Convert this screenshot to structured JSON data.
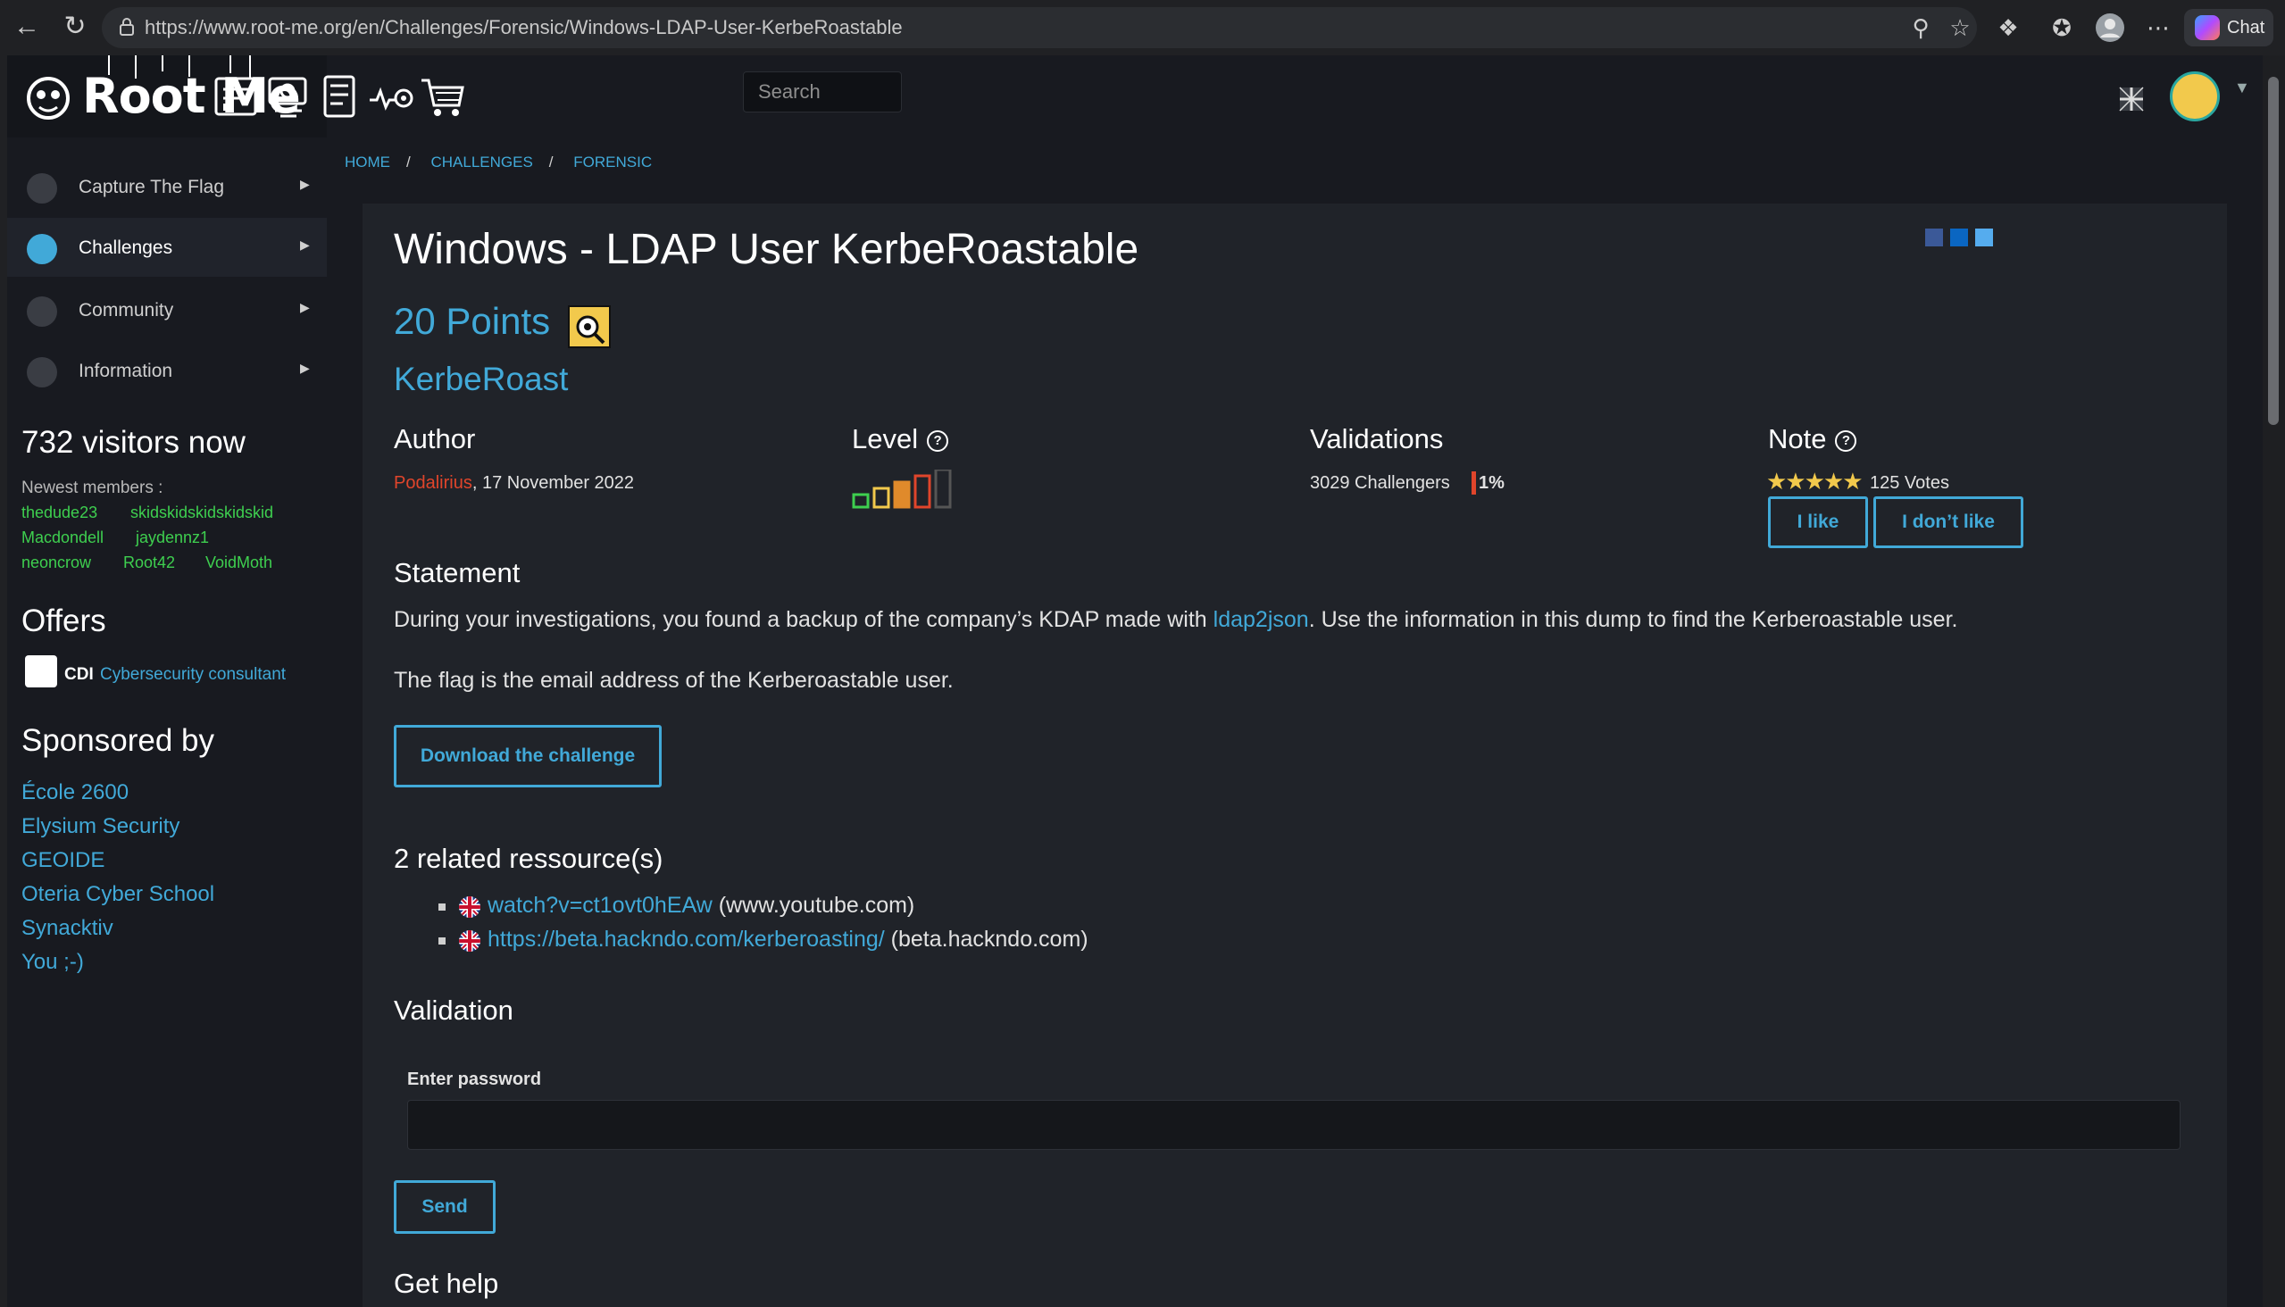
{
  "browser": {
    "url": "https://www.root-me.org/en/Challenges/Forensic/Windows-LDAP-User-KerbeRoastable",
    "chat_label": "Chat"
  },
  "header": {
    "logo_text": "Root Me",
    "search_placeholder": "Search",
    "icons": [
      "challenges-icon",
      "ctf-icon",
      "documentation-icon",
      "tools-icon",
      "shop-icon"
    ]
  },
  "sidebar": {
    "items": [
      {
        "label": "Capture The Flag",
        "icon": "flag-icon"
      },
      {
        "label": "Challenges",
        "icon": "challenges-icon"
      },
      {
        "label": "Community",
        "icon": "community-icon"
      },
      {
        "label": "Information",
        "icon": "information-icon"
      }
    ],
    "visitors": "732 visitors now",
    "newest_label": "Newest members :",
    "members": [
      "thedude23",
      "skidskidskidskidskid",
      "Macdondell",
      "jaydennz1",
      "neoncrow",
      "Root42",
      "VoidMoth"
    ],
    "offers_title": "Offers",
    "offer_company": "CDI",
    "offer_link": "Cybersecurity consultant",
    "sponsored_title": "Sponsored by",
    "sponsors": [
      "École 2600",
      "Elysium Security",
      "GEOIDE",
      "Oteria Cyber School",
      "Synacktiv",
      "You ;-)"
    ]
  },
  "breadcrumb": [
    "HOME",
    "CHALLENGES",
    "FORENSIC"
  ],
  "challenge": {
    "title": "Windows - LDAP User KerbeRoastable",
    "points": "20 Points",
    "tag": "KerbeRoast",
    "author_label": "Author",
    "author_name": "Podalirius",
    "author_date": ", 17 November 2022",
    "level_label": "Level",
    "level_value": 3,
    "level_max": 5,
    "validations_label": "Validations",
    "validations_count": "3029 Challengers",
    "validations_pct": "1%",
    "note_label": "Note",
    "stars": "★★★★★",
    "votes": "125 Votes",
    "like_label": "I like",
    "dislike_label": "I don’t like",
    "statement_title": "Statement",
    "statement_1a": "During your investigations, you found a backup of the company’s KDAP made with ",
    "statement_1_link": "ldap2json",
    "statement_1b": ". Use the information in this dump to find the Kerberoastable user.",
    "statement_2": "The flag is the email address of the Kerberoastable user.",
    "download_label": "Download the challenge",
    "resources_title": "2 related ressource(s)",
    "resources": [
      {
        "link": "watch?v=ct1ovt0hEAw",
        "domain": " (www.youtube.com)"
      },
      {
        "link": "https://beta.hackndo.com/kerberoasting/",
        "domain": " (beta.hackndo.com)"
      }
    ],
    "validation_title": "Validation",
    "password_label": "Enter password",
    "send_label": "Send",
    "help_title": "Get help"
  },
  "colors": {
    "accent": "#41a9d8",
    "member_green": "#3ecf4f",
    "author_red": "#e0452b"
  }
}
